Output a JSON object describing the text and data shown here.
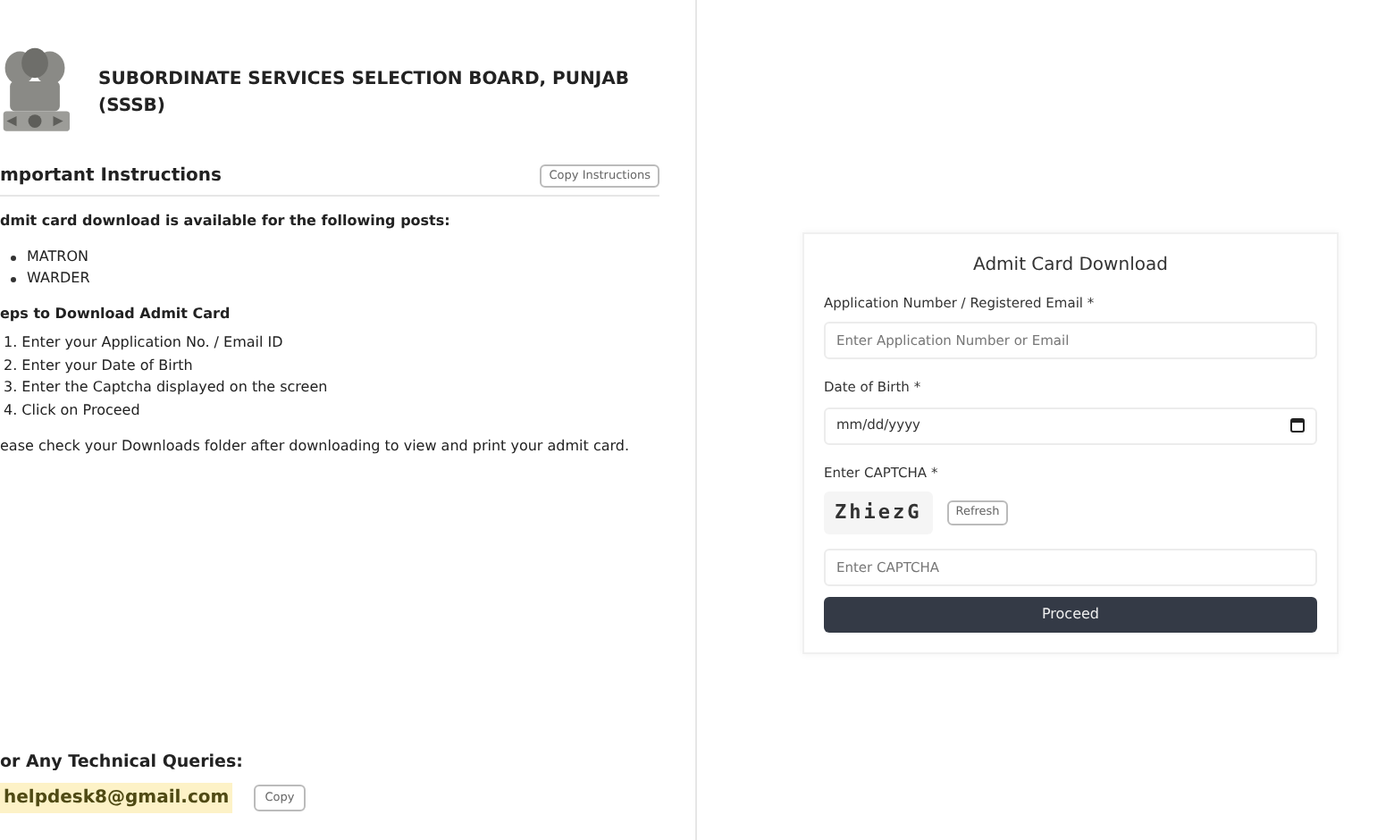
{
  "header": {
    "title": "SUBORDINATE SERVICES SELECTION BOARD, PUNJAB (SSSB)"
  },
  "instructions": {
    "heading": "mportant Instructions",
    "copy_button": "Copy Instructions",
    "intro": "dmit card download is available for the following posts:",
    "posts": [
      "MATRON",
      "WARDER"
    ],
    "steps_heading": "eps to Download Admit Card",
    "steps": [
      "1. Enter your Application No. / Email ID",
      "2. Enter your Date of Birth",
      "3. Enter the Captcha displayed on the screen",
      "4. Click on Proceed"
    ],
    "note": "ease check your Downloads folder after downloading to view and print your admit card."
  },
  "support": {
    "heading": "or Any Technical Queries:",
    "email": "helpdesk8@gmail.com",
    "copy_button": "Copy"
  },
  "form": {
    "title": "Admit Card Download",
    "fields": [
      {
        "kind": "text",
        "label": "Application Number / Registered Email *",
        "placeholder": "Enter Application Number or Email"
      },
      {
        "kind": "date",
        "label": "Date of Birth *",
        "value": "mm/dd/yyyy"
      },
      {
        "kind": "captcha",
        "label": "Enter CAPTCHA *",
        "captcha": "ZhiezG",
        "refresh": "Refresh",
        "placeholder": "Enter CAPTCHA"
      }
    ],
    "submit": "Proceed"
  }
}
